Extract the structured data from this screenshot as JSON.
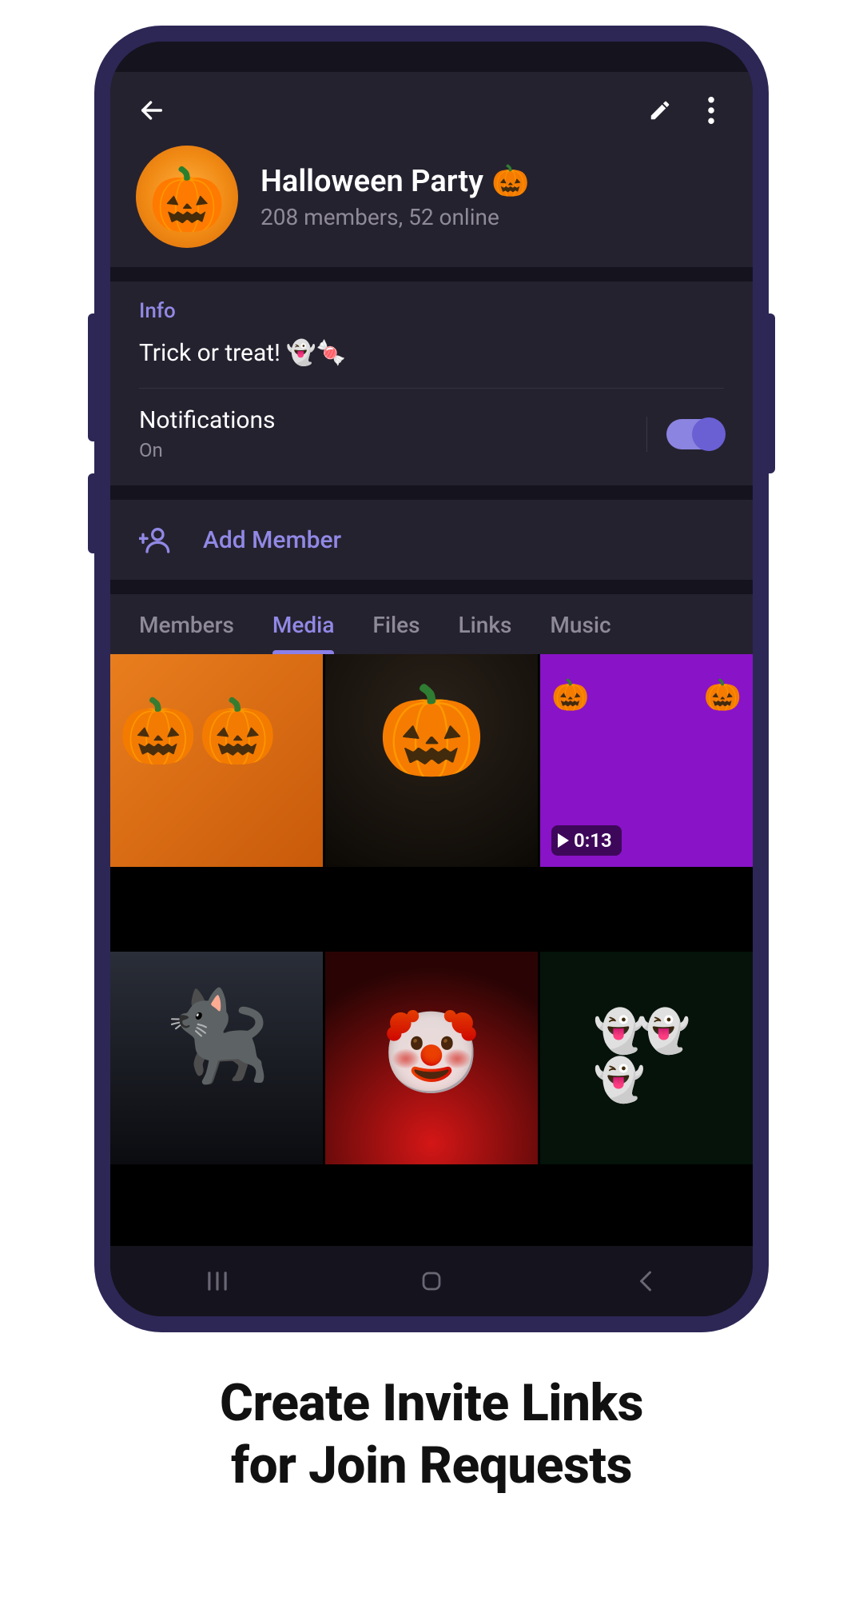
{
  "header": {
    "title": "Halloween Party",
    "title_emoji": "🎃",
    "subtitle": "208 members, 52 online"
  },
  "info": {
    "section_label": "Info",
    "description": "Trick or treat! 👻🍬"
  },
  "notifications": {
    "label": "Notifications",
    "state_label": "On",
    "enabled": true
  },
  "actions": {
    "add_member": "Add Member"
  },
  "tabs": {
    "items": [
      "Members",
      "Media",
      "Files",
      "Links",
      "Music"
    ],
    "active_index": 1
  },
  "media": {
    "tiles": [
      {
        "name": "pumpkins-pile"
      },
      {
        "name": "jack-o-lantern"
      },
      {
        "name": "purple-pumpkins-video",
        "video_duration": "0:13"
      },
      {
        "name": "black-cat"
      },
      {
        "name": "clown-makeup"
      },
      {
        "name": "ghost-yard-decor"
      }
    ]
  },
  "caption": {
    "line1": "Create Invite Links",
    "line2": "for Join Requests"
  },
  "colors": {
    "accent": "#8b7fe8",
    "panel": "#25222f",
    "screen": "#15131d",
    "frame": "#2d2756"
  }
}
